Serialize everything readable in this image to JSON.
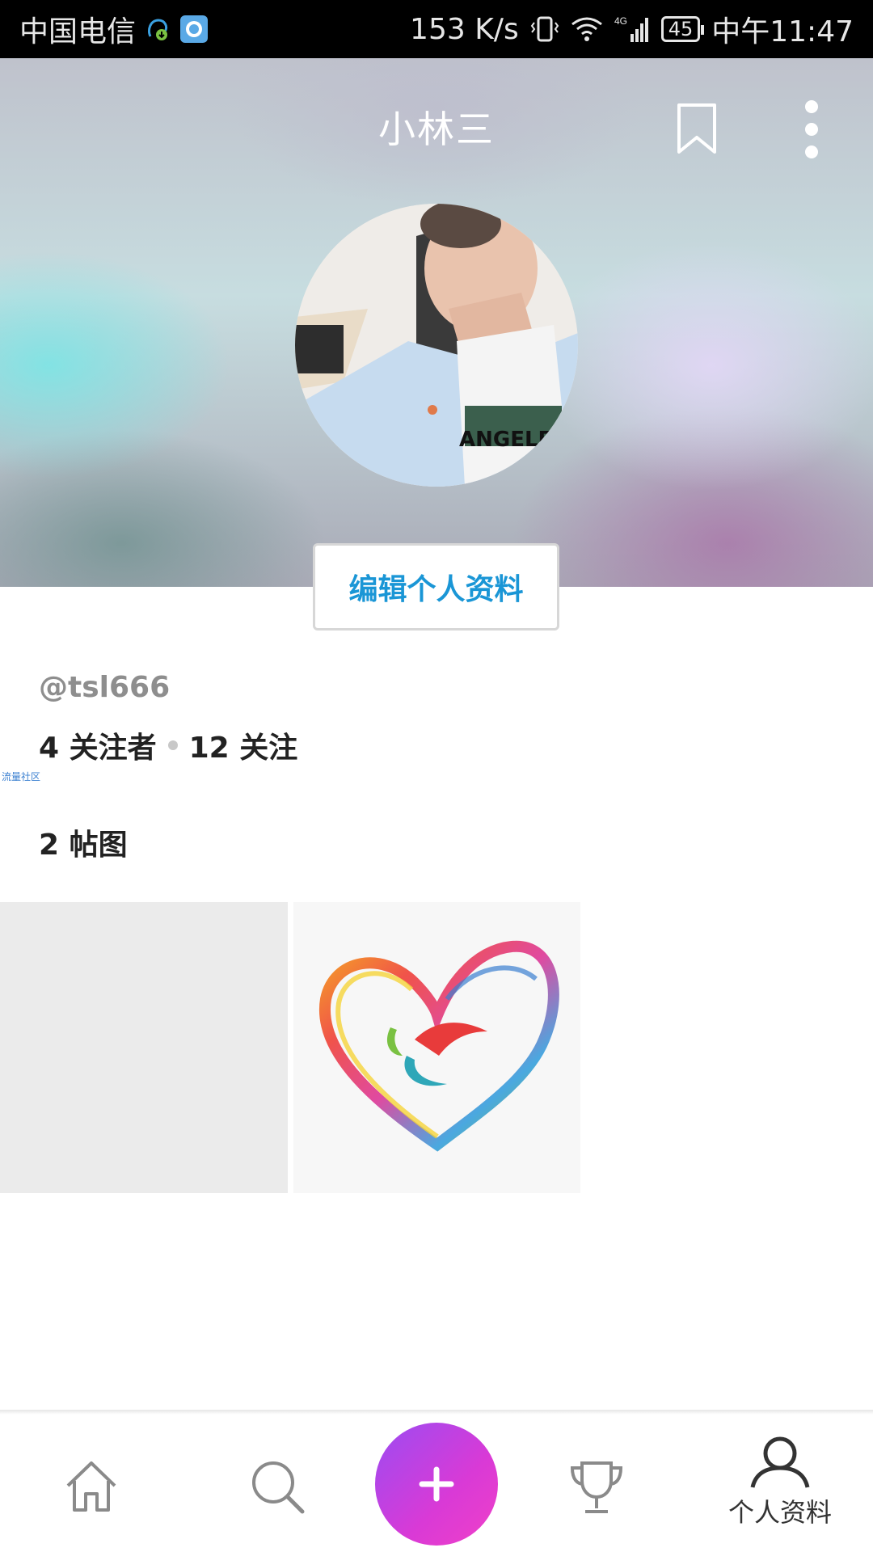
{
  "status_bar": {
    "carrier": "中国电信",
    "speed": "153 K/s",
    "network": "4G",
    "battery": "45",
    "time": "中午11:47"
  },
  "header": {
    "title": "小林三",
    "icons": [
      "bookmark-icon",
      "more-vertical-icon"
    ]
  },
  "profile": {
    "edit_button_label": "编辑个人资料",
    "username": "@tsl666",
    "followers_label": "4 关注者",
    "following_label": "12 关注",
    "watermark": "流量社区",
    "posts_label": "2 帖图"
  },
  "bottom_nav": {
    "items": [
      {
        "icon": "home-icon"
      },
      {
        "icon": "search-icon"
      },
      {
        "icon": "plus-icon"
      },
      {
        "icon": "trophy-icon"
      },
      {
        "icon": "profile-icon",
        "label": "个人资料"
      }
    ]
  },
  "colors": {
    "accent_link": "#1a96d6",
    "fab_start": "#9b4cf2",
    "fab_end": "#f040c8"
  }
}
